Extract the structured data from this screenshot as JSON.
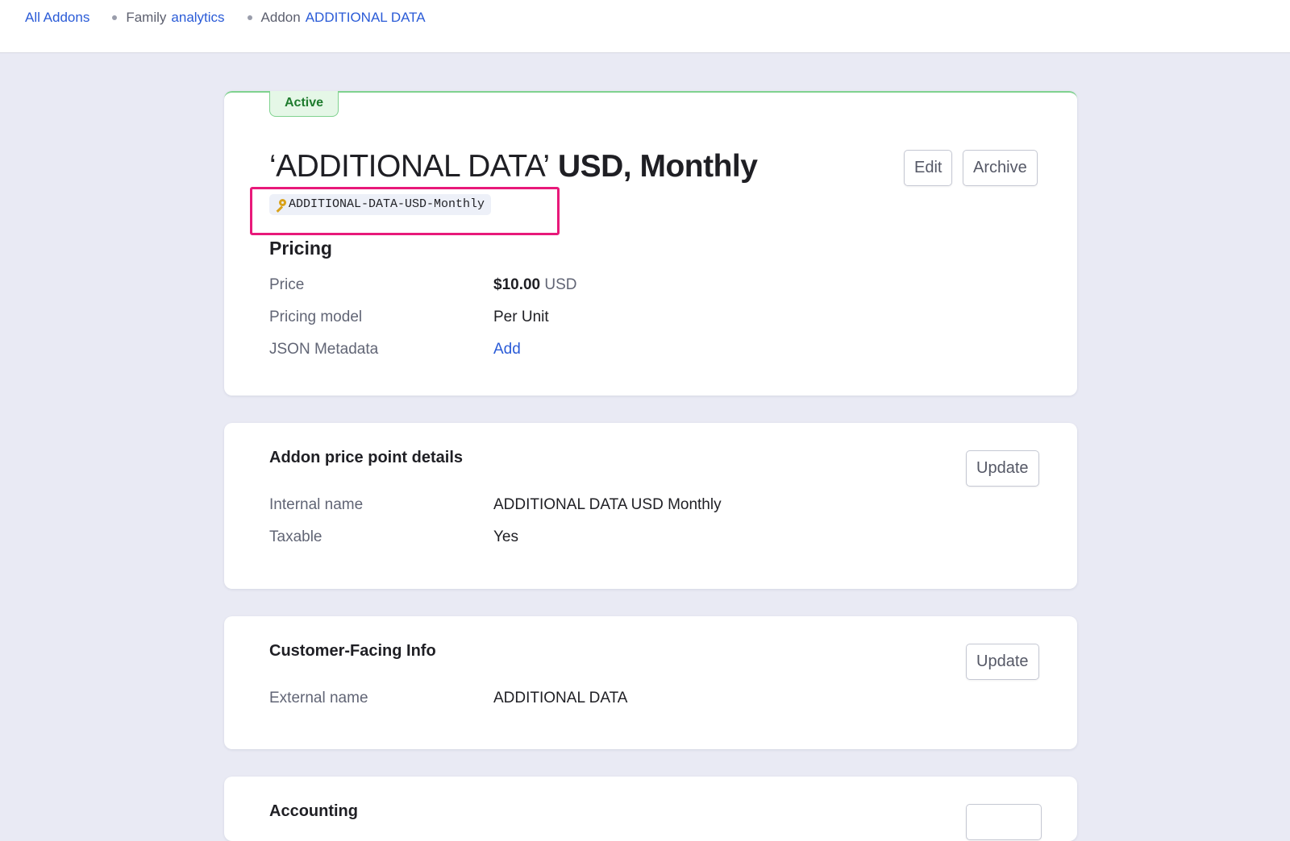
{
  "breadcrumb": {
    "all_addons": "All Addons",
    "family_prefix": "Family",
    "family_name": "analytics",
    "addon_prefix": "Addon",
    "addon_name": "ADDITIONAL DATA"
  },
  "header_card": {
    "status_badge": "Active",
    "title_name": "‘ADDITIONAL DATA’",
    "title_currency_interval": "USD, Monthly",
    "handle": "ADDITIONAL-DATA-USD-Monthly",
    "edit_label": "Edit",
    "archive_label": "Archive",
    "pricing": {
      "heading": "Pricing",
      "price_label": "Price",
      "price_amount": "$10.00",
      "price_currency": "USD",
      "model_label": "Pricing model",
      "model_value": "Per Unit",
      "metadata_label": "JSON Metadata",
      "metadata_action": "Add"
    }
  },
  "price_point_card": {
    "heading": "Addon price point details",
    "update_label": "Update",
    "internal_name_label": "Internal name",
    "internal_name_value": "ADDITIONAL DATA USD Monthly",
    "taxable_label": "Taxable",
    "taxable_value": "Yes"
  },
  "customer_card": {
    "heading": "Customer-Facing Info",
    "update_label": "Update",
    "external_name_label": "External name",
    "external_name_value": "ADDITIONAL DATA"
  },
  "accounting_card": {
    "heading": "Accounting"
  },
  "colors": {
    "link": "#2a5bd7",
    "active_badge_border": "#7fd28f",
    "highlight": "#e8197a",
    "page_background": "#e9eaf4"
  }
}
